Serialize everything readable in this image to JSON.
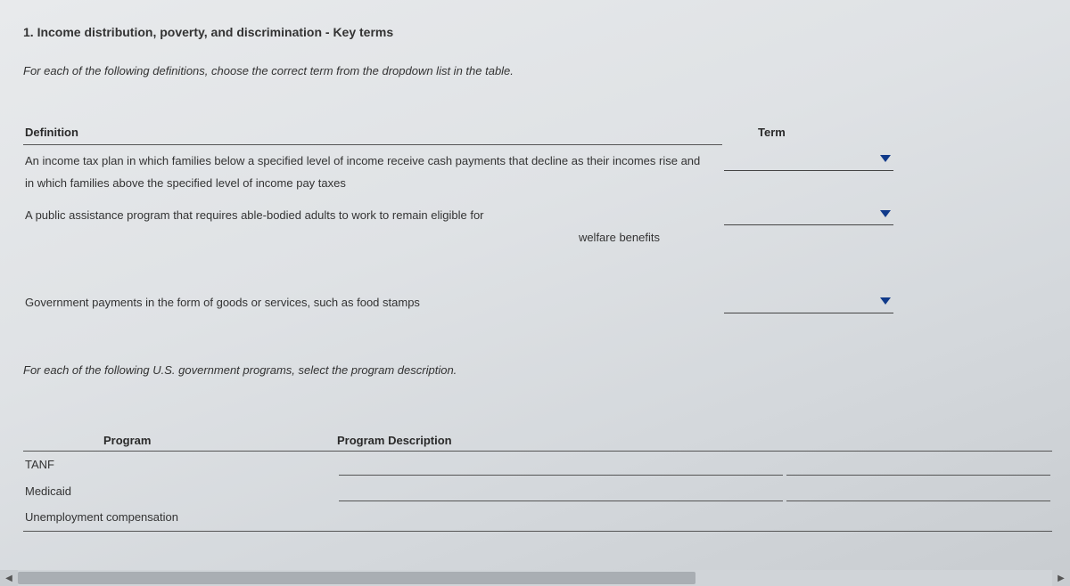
{
  "question_title": "1. Income distribution, poverty, and discrimination - Key terms",
  "instruction_1": "For each of the following definitions, choose the correct term from the dropdown list in the table.",
  "table1": {
    "header_definition": "Definition",
    "header_term": "Term",
    "rows": [
      {
        "definition": "An income tax plan in which families below a specified level of income receive cash payments that decline as their incomes rise and in which families above the specified level of income pay taxes"
      },
      {
        "definition_line1": "A public assistance program that requires able-bodied adults to work to remain eligible for",
        "definition_line2": "welfare benefits"
      },
      {
        "definition": "Government payments in the form of goods or services, such as food stamps"
      }
    ]
  },
  "instruction_2": "For each of the following U.S. government programs, select the program description.",
  "table2": {
    "header_program": "Program",
    "header_description": "Program Description",
    "rows": [
      {
        "program": "TANF"
      },
      {
        "program": "Medicaid"
      },
      {
        "program": "Unemployment compensation"
      }
    ]
  },
  "scroll": {
    "left_arrow": "◀",
    "right_arrow": "▶"
  }
}
